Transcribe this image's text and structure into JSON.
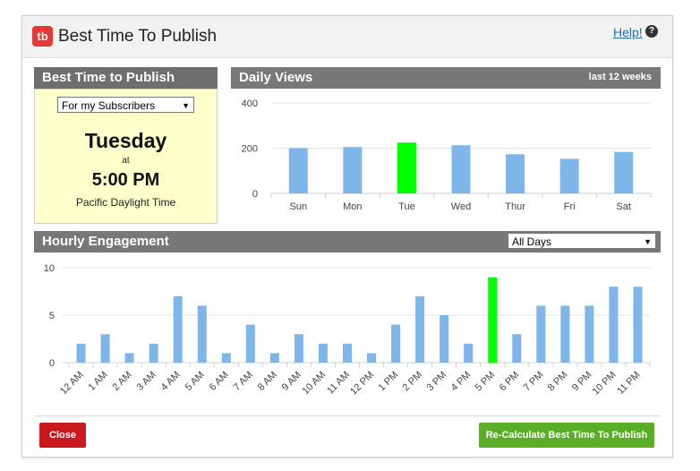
{
  "dialog": {
    "title": "Best Time To Publish",
    "logo_text": "tb",
    "help_label": "Help!",
    "help_icon": "question-icon"
  },
  "best_time": {
    "header": "Best Time to Publish",
    "audience_select": "For my Subscribers",
    "day": "Tuesday",
    "at_label": "at",
    "time": "5:00 PM",
    "timezone": "Pacific Daylight Time"
  },
  "daily_views": {
    "header": "Daily Views",
    "range": "last 12 weeks"
  },
  "hourly": {
    "header": "Hourly Engagement",
    "days_select": "All Days"
  },
  "buttons": {
    "close": "Close",
    "recalculate": "Re-Calculate Best Time To Publish"
  },
  "colors": {
    "bar": "#7eb6ea",
    "highlight": "#00ff00",
    "close_button": "#c9191e",
    "recalc_button": "#5aae27",
    "logo": "#e53935"
  },
  "chart_data": [
    {
      "type": "bar",
      "categories": [
        "Sun",
        "Mon",
        "Tue",
        "Wed",
        "Thur",
        "Fri",
        "Sat"
      ],
      "values": [
        200,
        205,
        225,
        213,
        173,
        153,
        183
      ],
      "highlight_index": 2,
      "yticks": [
        0,
        200,
        400
      ],
      "ylim": [
        0,
        400
      ],
      "grid": true
    },
    {
      "type": "bar",
      "categories": [
        "12 AM",
        "1 AM",
        "2 AM",
        "3 AM",
        "4 AM",
        "5 AM",
        "6 AM",
        "7 AM",
        "8 AM",
        "9 AM",
        "10 AM",
        "11 AM",
        "12 PM",
        "1 PM",
        "2 PM",
        "3 PM",
        "4 PM",
        "5 PM",
        "6 PM",
        "7 PM",
        "8 PM",
        "9 PM",
        "10 PM",
        "11 PM"
      ],
      "values": [
        2,
        3,
        1,
        2,
        7,
        6,
        1,
        4,
        1,
        3,
        2,
        2,
        1,
        4,
        7,
        5,
        2,
        9,
        3,
        6,
        6,
        6,
        8,
        8
      ],
      "highlight_index": 17,
      "yticks": [
        0,
        5,
        10
      ],
      "ylim": [
        0,
        10
      ],
      "grid": true
    }
  ]
}
